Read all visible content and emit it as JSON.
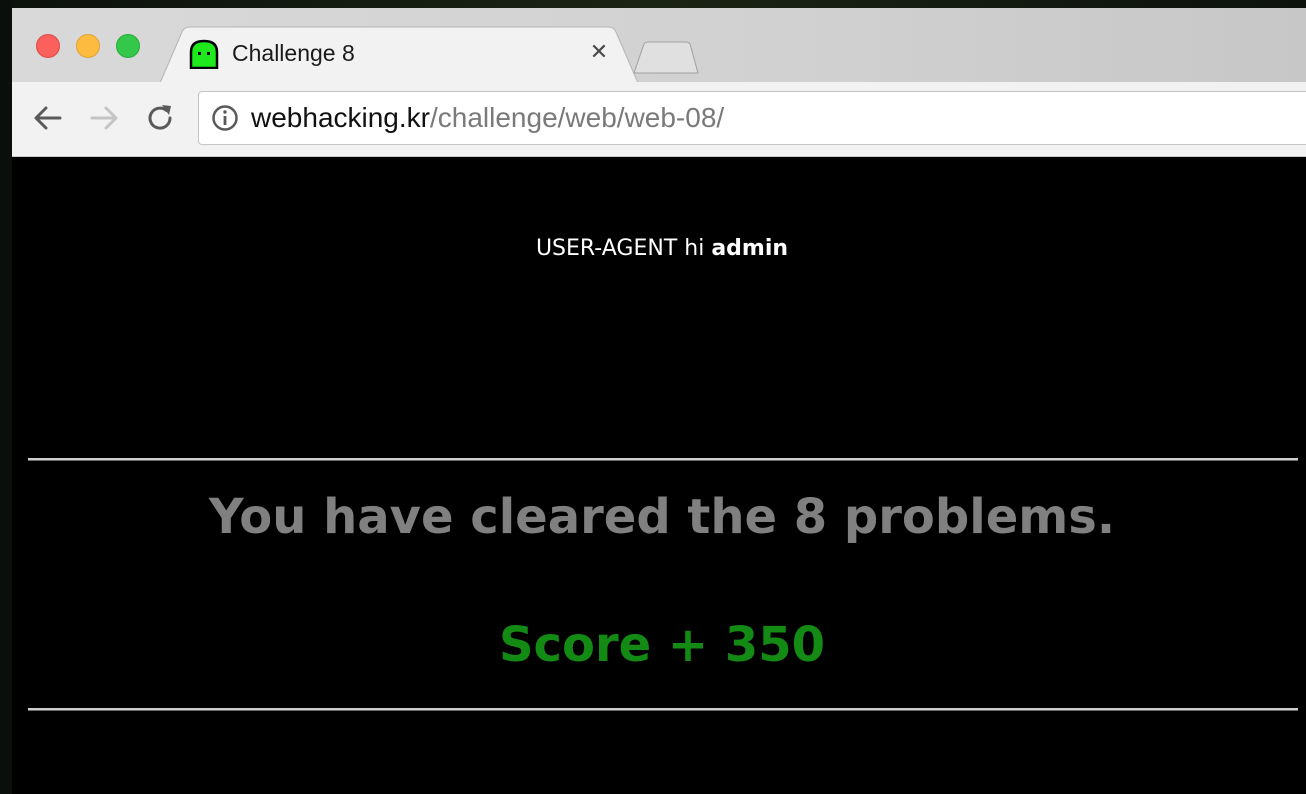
{
  "browser": {
    "tab": {
      "title": "Challenge 8",
      "close_glyph": "✕",
      "favicon": "green-ghost-icon"
    },
    "address_bar": {
      "host": "webhacking.kr",
      "path": "/challenge/web/web-08/"
    },
    "nav": {
      "back": "back-arrow-icon",
      "forward": "forward-arrow-icon",
      "reload": "reload-icon",
      "info": "info-icon"
    }
  },
  "page": {
    "ua_prefix": "USER-AGENT hi ",
    "ua_user": "admin",
    "cleared_message": "You have cleared the 8 problems.",
    "score_message": "Score + 350"
  },
  "colors": {
    "background": "#000000",
    "cleared_text": "#808080",
    "score_text": "#138a13",
    "favicon": "#1de91d"
  }
}
